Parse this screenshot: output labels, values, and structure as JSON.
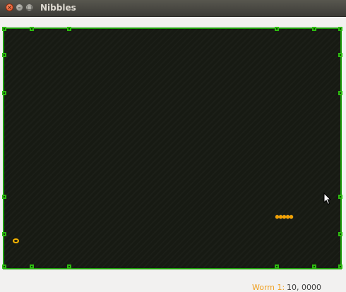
{
  "window": {
    "title": "Nibbles",
    "close_glyph": "×",
    "minimize_glyph": "–",
    "maximize_glyph": "□"
  },
  "board": {
    "wall_color": "#1d9d0a",
    "background_color": "#171a13"
  },
  "worm": {
    "color": "#f3a100",
    "segments": 5
  },
  "bonus": {
    "icon": "ring-bonus-icon",
    "color": "#f5b400"
  },
  "statusbar": {
    "worm_label": "Worm 1:",
    "worm_score": "10, 0000"
  }
}
